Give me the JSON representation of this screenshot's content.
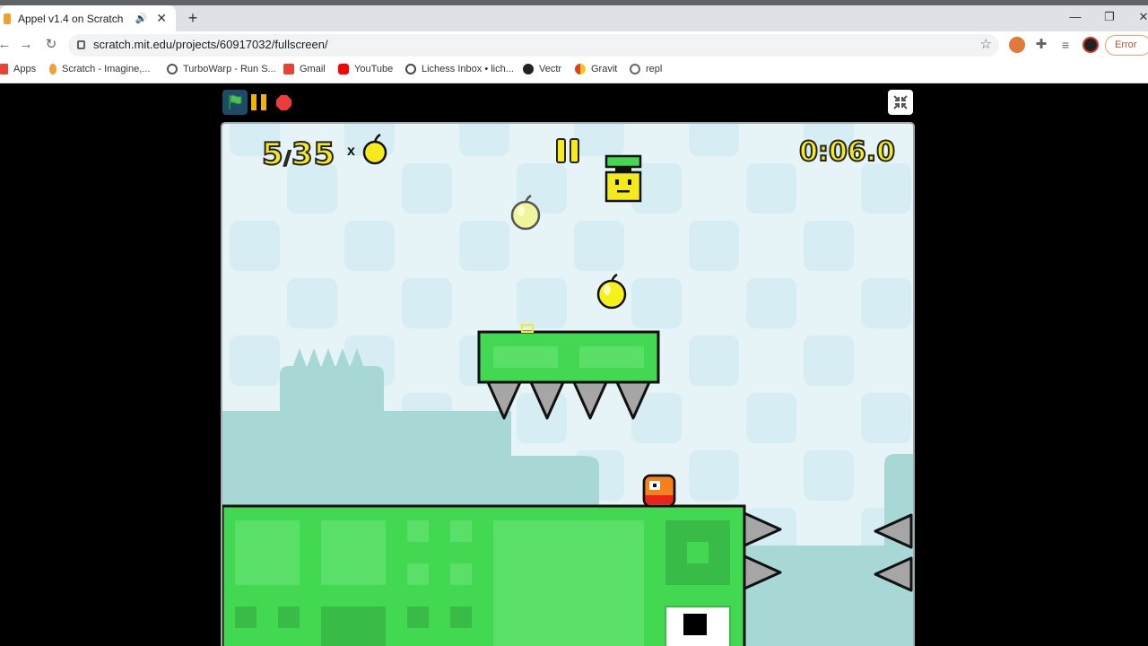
{
  "browser": {
    "tab_title": "Appel v1.4 on Scratch",
    "new_tab": "+",
    "window_controls": [
      "—",
      "❐",
      "✕"
    ],
    "url": "scratch.mit.edu/projects/60917032/fullscreen/",
    "profile_status": "Error",
    "bookmarks": [
      {
        "label": "Apps",
        "icon": "apps-grid-icon",
        "color": "#ea4335"
      },
      {
        "label": "Scratch - Imagine,...",
        "icon": "scratch-icon",
        "color": "#f0a030"
      },
      {
        "label": "TurboWarp - Run S...",
        "icon": "turbowarp-icon",
        "color": "#555555"
      },
      {
        "label": "Gmail",
        "icon": "gmail-icon",
        "color": "#ea4335"
      },
      {
        "label": "YouTube",
        "icon": "youtube-icon",
        "color": "#ff0000"
      },
      {
        "label": "Lichess Inbox • lich...",
        "icon": "lichess-icon",
        "color": "#444444"
      },
      {
        "label": "Vectr",
        "icon": "vectr-icon",
        "color": "#222222"
      },
      {
        "label": "Gravit",
        "icon": "gravit-icon",
        "color": "#e04020"
      },
      {
        "label": "repl",
        "icon": "repl-icon",
        "color": "#666666"
      }
    ]
  },
  "game": {
    "apples_collected": "5",
    "apples_separator": "/",
    "apples_total": "35",
    "multiplier": "x",
    "timer": "0:06.0",
    "colors": {
      "sky": "#e6f4f8",
      "tile": "#d6edf3",
      "hill": "#a8d8d6",
      "grass": "#42d852",
      "grass_dark": "#38bb47",
      "spike": "#a6a6a6",
      "apple": "#f5f21a",
      "player": "#f4801e",
      "hud_yellow": "#f5ea1c"
    }
  }
}
